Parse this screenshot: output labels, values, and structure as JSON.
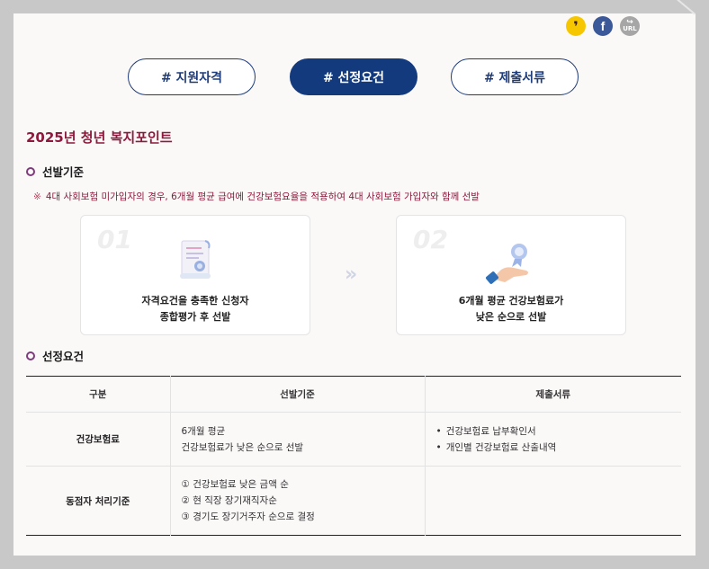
{
  "share": {
    "kakao_glyph": "❜",
    "fb_glyph": "f",
    "url_text": "URL",
    "url_arrow": "↪"
  },
  "tabs": [
    {
      "label": "# 지원자격",
      "active": false
    },
    {
      "label": "# 선정요건",
      "active": true
    },
    {
      "label": "# 제출서류",
      "active": false
    }
  ],
  "title": "2025년 청년 복지포인트",
  "selection": {
    "heading": "선발기준",
    "note_mark": "※",
    "note": "4대 사회보험 미가입자의 경우, 6개월 평균 급여에 건강보험요율을 적용하여 4대 사회보험 가입자와 함께 선발",
    "steps": [
      {
        "num": "01",
        "line1": "자격요건을 충족한 신청자",
        "line2": "종합평가 후 선발",
        "icon": "certificate-icon"
      },
      {
        "num": "02",
        "line1": "6개월 평균 건강보험료가",
        "line2": "낮은 순으로 선발",
        "icon": "hand-badge-icon"
      }
    ],
    "arrow": "»"
  },
  "requirements": {
    "heading": "선정요건",
    "columns": [
      "구분",
      "선발기준",
      "제출서류"
    ],
    "rows": [
      {
        "category": "건강보험료",
        "criteria": [
          "6개월 평균",
          "건강보험료가 낮은 순으로 선발"
        ],
        "documents": [
          "건강보험료 납부확인서",
          "개인별 건강보험료 산출내역"
        ]
      },
      {
        "category": "동점자 처리기준",
        "criteria": [
          "① 건강보험료 낮은 금액 순",
          "② 현 직장 장기재직자순",
          "③ 경기도 장기거주자 순으로 결정"
        ],
        "documents": []
      }
    ]
  },
  "colors": {
    "accent": "#143a7e",
    "title": "#8b1a3c",
    "bullet_ring": "#7e3b7c"
  }
}
